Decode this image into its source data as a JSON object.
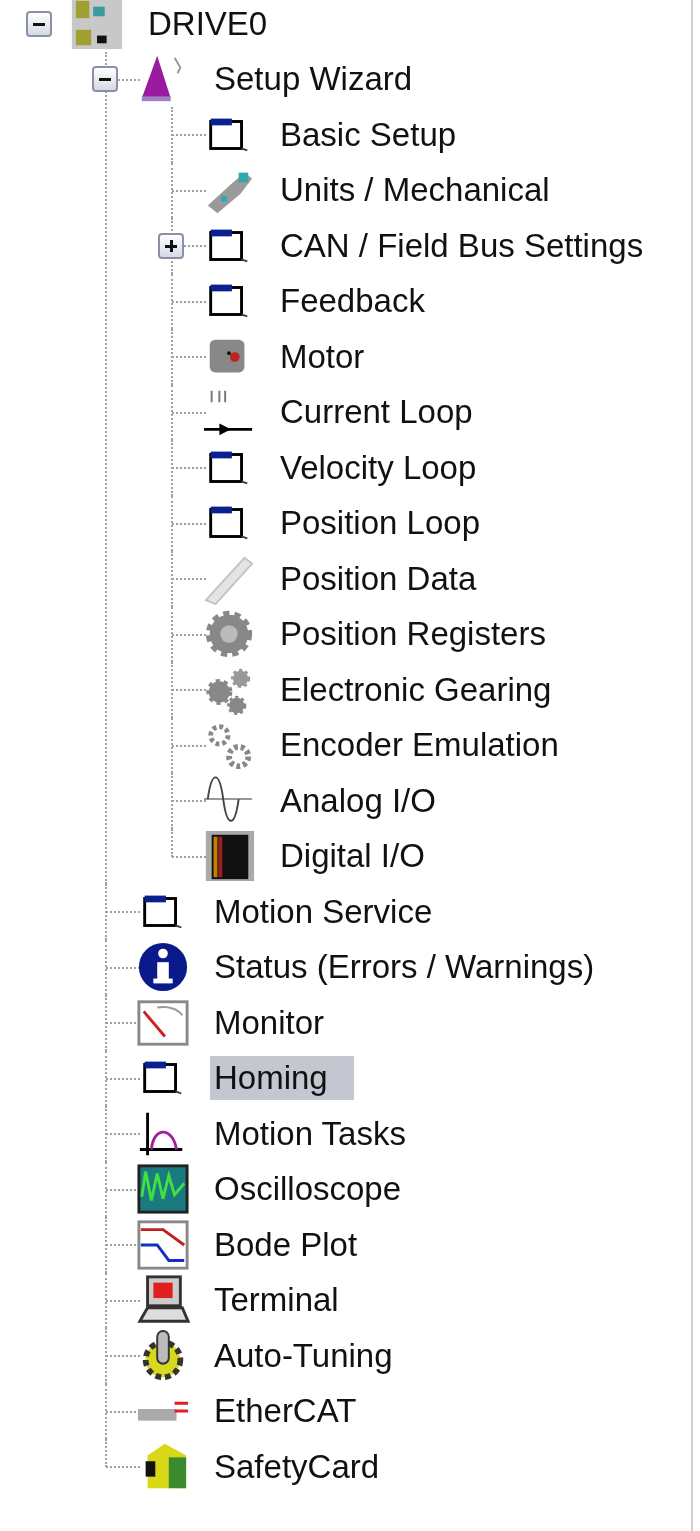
{
  "tree": {
    "label": "DRIVE0",
    "kind": "drive",
    "expanded": true,
    "selected": false,
    "children": [
      {
        "label": "Setup Wizard",
        "kind": "wizard",
        "expanded": true,
        "selected": false,
        "children": [
          {
            "label": "Basic Setup",
            "kind": "page",
            "selected": false
          },
          {
            "label": "Units / Mechanical",
            "kind": "mechanics",
            "selected": false
          },
          {
            "label": "CAN / Field Bus Settings",
            "kind": "page",
            "expanded": false,
            "selected": false
          },
          {
            "label": "Feedback",
            "kind": "page",
            "selected": false
          },
          {
            "label": "Motor",
            "kind": "motor",
            "selected": false
          },
          {
            "label": "Current Loop",
            "kind": "current",
            "selected": false
          },
          {
            "label": "Velocity Loop",
            "kind": "page",
            "selected": false
          },
          {
            "label": "Position Loop",
            "kind": "page",
            "selected": false
          },
          {
            "label": "Position Data",
            "kind": "ruler",
            "selected": false
          },
          {
            "label": "Position Registers",
            "kind": "gear",
            "selected": false
          },
          {
            "label": "Electronic Gearing",
            "kind": "gears",
            "selected": false
          },
          {
            "label": "Encoder Emulation",
            "kind": "gears2",
            "selected": false
          },
          {
            "label": "Analog I/O",
            "kind": "analog",
            "selected": false
          },
          {
            "label": "Digital I/O",
            "kind": "digital",
            "selected": false
          }
        ]
      },
      {
        "label": "Motion Service",
        "kind": "page",
        "selected": false
      },
      {
        "label": "Status (Errors / Warnings)",
        "kind": "info",
        "selected": false
      },
      {
        "label": "Monitor",
        "kind": "monitor",
        "selected": false
      },
      {
        "label": "Homing",
        "kind": "page",
        "selected": true
      },
      {
        "label": "Motion Tasks",
        "kind": "profile",
        "selected": false
      },
      {
        "label": "Oscilloscope",
        "kind": "scope",
        "selected": false
      },
      {
        "label": "Bode Plot",
        "kind": "bode",
        "selected": false
      },
      {
        "label": "Terminal",
        "kind": "terminal",
        "selected": false
      },
      {
        "label": "Auto-Tuning",
        "kind": "autotune",
        "selected": false
      },
      {
        "label": "EtherCAT",
        "kind": "ethercat",
        "selected": false
      },
      {
        "label": "SafetyCard",
        "kind": "safety",
        "selected": false
      }
    ]
  }
}
